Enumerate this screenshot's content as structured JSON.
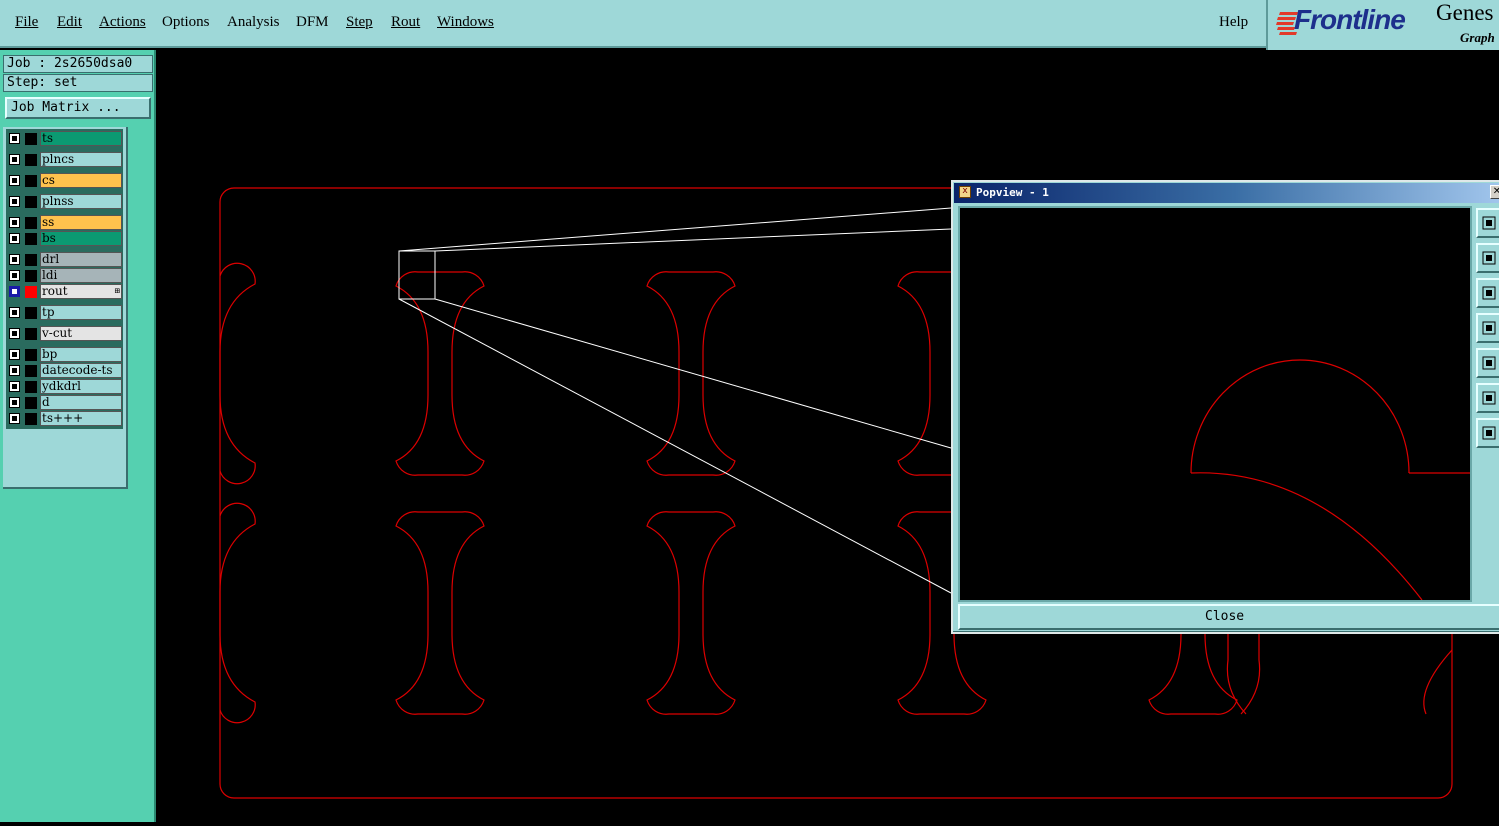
{
  "menu": {
    "items": [
      {
        "label": "File"
      },
      {
        "label": "Edit"
      },
      {
        "label": "Actions"
      },
      {
        "label": "Options"
      },
      {
        "label": "Analysis"
      },
      {
        "label": "DFM"
      },
      {
        "label": "Step"
      },
      {
        "label": "Rout"
      },
      {
        "label": "Windows"
      }
    ],
    "help": "Help"
  },
  "logo": {
    "brand": "Frontline",
    "product": "Genes",
    "tagline": "Graph"
  },
  "job": {
    "job_line": "Job : 2s2650dsa0",
    "step_line": "Step: set",
    "matrix_button": "Job Matrix ..."
  },
  "layers": [
    {
      "name": "ts",
      "color": "#0b9a72",
      "active": false
    },
    {
      "name": "plncs",
      "color": "#9ed8d8",
      "active": false
    },
    {
      "name": "cs",
      "color": "#ffc24d",
      "active": false
    },
    {
      "name": "plnss",
      "color": "#9ed8d8",
      "active": false
    },
    {
      "name": "ss",
      "color": "#ffc24d",
      "active": false
    },
    {
      "name": "bs",
      "color": "#0b9a72",
      "active": false
    },
    {
      "name": "drl",
      "color": "#a6b4b8",
      "active": false
    },
    {
      "name": "ldi",
      "color": "#a6b4b8",
      "active": false
    },
    {
      "name": "rout",
      "color": "#e4e4e4",
      "active": true,
      "indicator_color": "#ff0000",
      "edit_mark": "⊞"
    },
    {
      "name": "tp",
      "color": "#9ed8d8",
      "active": false
    },
    {
      "name": "v-cut",
      "color": "#e4e4e4",
      "active": false
    },
    {
      "name": "bp",
      "color": "#9ed8d8",
      "active": false
    },
    {
      "name": "datecode-ts",
      "color": "#9ed8d8",
      "active": false
    },
    {
      "name": "ydkdrl",
      "color": "#9ed8d8",
      "active": false
    },
    {
      "name": "d",
      "color": "#9ed8d8",
      "active": false
    },
    {
      "name": "ts+++",
      "color": "#9ed8d8",
      "active": false
    }
  ],
  "popview": {
    "title": "Popview - 1",
    "icon": "x",
    "close_x": "✕",
    "close_button": "Close",
    "tools": [
      {
        "icon": "zoom-home-icon"
      },
      {
        "icon": "pan-up-icon"
      },
      {
        "icon": "pan-down-icon"
      },
      {
        "icon": "pan-left-icon"
      },
      {
        "icon": "pan-right-icon"
      },
      {
        "icon": "zoom-in-icon"
      },
      {
        "icon": "zoom-out-icon"
      }
    ]
  },
  "colors": {
    "rout_line": "#dd0000",
    "zoom_frame": "#ffffff",
    "ui_bg": "#9ed8d8",
    "panel_bg": "#55d0b0"
  }
}
